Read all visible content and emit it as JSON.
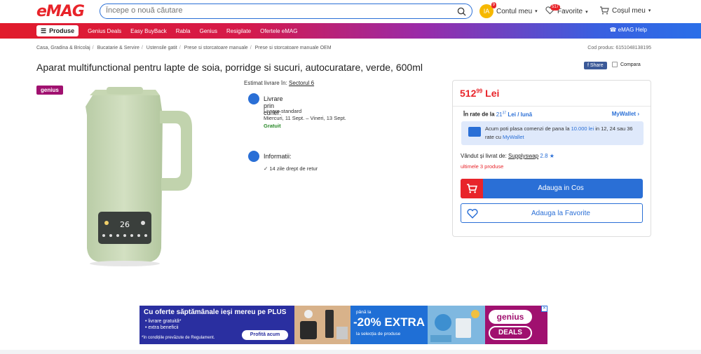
{
  "header": {
    "logo": "eMAG",
    "search_placeholder": "Începe o nouă căutare",
    "account_initials": "IA",
    "account_badge": "9",
    "account_label": "Contul meu",
    "fav_badge": "517",
    "fav_label": "Favorite",
    "cart_label": "Coșul meu"
  },
  "nav": {
    "products_label": "Produse",
    "items": [
      "Genius Deals",
      "Easy BuyBack",
      "Rabla",
      "Genius",
      "Resigilate",
      "Ofertele eMAG"
    ],
    "help_label": "eMAG Help"
  },
  "breadcrumb": {
    "items": [
      "Casa, Gradina & Bricolaj",
      "Bucatarie & Servire",
      "Ustensile gatit",
      "Prese si storcatoare manuale",
      "Prese si storcatoare manuale OEM"
    ],
    "separator": "/",
    "product_code": "Cod produs: 6151048138195"
  },
  "product": {
    "title": "Aparat multifunctional pentru lapte de soia, porridge si sucuri, autocuratare, verde, 600ml",
    "genius_tag": "genius",
    "share_label": "Share",
    "compare_label": "Compara",
    "display_value": "26"
  },
  "delivery": {
    "estimate_label": "Estimat livrare în:",
    "estimate_location": "Sectorul 6",
    "courier_title": "Livrare prin curier:",
    "courier_type": "Livrare standard",
    "courier_dates": "Miercuri, 11 Sept. – Vineri, 13 Sept.",
    "courier_price": "Gratuit",
    "info_title": "Informatii:",
    "return_text": "14 zile drept de retur"
  },
  "buybox": {
    "price_int": "512",
    "price_dec": "99",
    "currency": "Lei",
    "rates_prefix": "În rate de la",
    "rates_int": "21",
    "rates_dec": "37",
    "rates_suffix": "Lei / lună",
    "mywallet_label": "MyWallet",
    "wallet_text_1": "Acum poti plasa comenzi de pana la",
    "wallet_amount": "10.000 lei",
    "wallet_text_2": "in 12, 24 sau 36 rate cu",
    "wallet_link": "MyWallet",
    "seller_label": "Vândut și livrat de:",
    "seller_name": "Supplyswap",
    "seller_rating": "2.8",
    "stock": "ultimele 3 produse",
    "add_to_cart": "Adauga in Cos",
    "add_to_fav": "Adauga la Favorite"
  },
  "banner": {
    "headline": "Cu oferte săptămânale ieși mereu pe PLUS",
    "bullet_1": "• livrare gratuită*",
    "bullet_2": "• extra beneficii",
    "note": "*în condițiile prevăzute de Regulament.",
    "cta": "Profită acum",
    "promo_small": "până la",
    "promo_big": "-20% EXTRA",
    "promo_sub": "la selecția de produse",
    "genius_pill": "genius",
    "deals": "DEALS"
  },
  "colors": {
    "brand_red": "#e8242a",
    "brand_blue": "#2a6fd6",
    "genius_purple": "#a0106f"
  }
}
